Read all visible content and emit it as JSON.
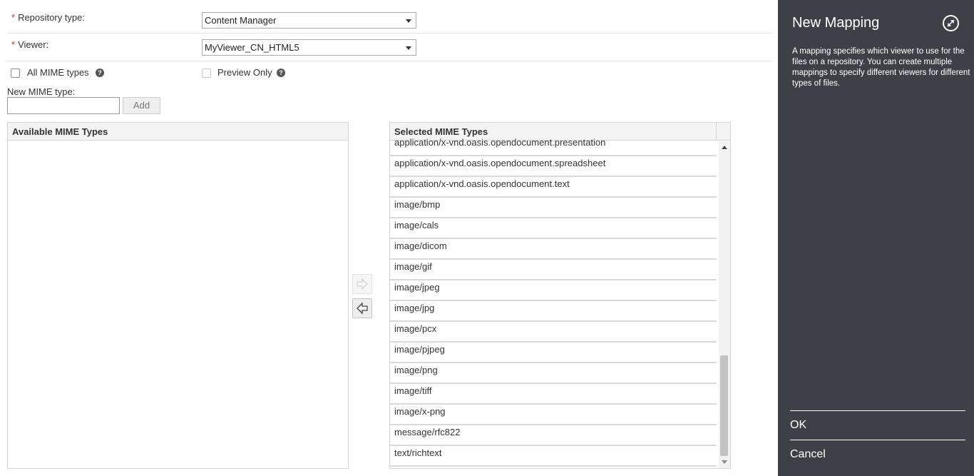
{
  "form": {
    "required_mark": "*",
    "repository_type_label": "Repository type:",
    "repository_type_value": "Content Manager",
    "viewer_label": "Viewer:",
    "viewer_value": "MyViewer_CN_HTML5",
    "all_mime_types_label": "All MIME types",
    "preview_only_label": "Preview Only",
    "help_glyph": "?",
    "new_mime_type_label": "New MIME type:",
    "new_mime_type_value": "",
    "add_button_label": "Add"
  },
  "available_list": {
    "header": "Available MIME Types",
    "items": []
  },
  "selected_list": {
    "header": "Selected MIME Types",
    "items": [
      "application/x-vnd.oasis.opendocument.presentation",
      "application/x-vnd.oasis.opendocument.spreadsheet",
      "application/x-vnd.oasis.opendocument.text",
      "image/bmp",
      "image/cals",
      "image/dicom",
      "image/gif",
      "image/jpeg",
      "image/jpg",
      "image/pcx",
      "image/pjpeg",
      "image/png",
      "image/tiff",
      "image/x-png",
      "message/rfc822",
      "text/richtext"
    ]
  },
  "flyout": {
    "title": "New Mapping",
    "description": "A mapping specifies which viewer to use for the files on a repository. You can create multiple mappings to specify different viewers for different types of files.",
    "ok_label": "OK",
    "cancel_label": "Cancel",
    "background_color": "#3d4147"
  },
  "icons": {
    "move_right": "arrow-right-icon",
    "move_left": "arrow-left-icon",
    "close": "collapse-icon",
    "help": "help-icon",
    "dropdown": "chevron-down-icon"
  }
}
